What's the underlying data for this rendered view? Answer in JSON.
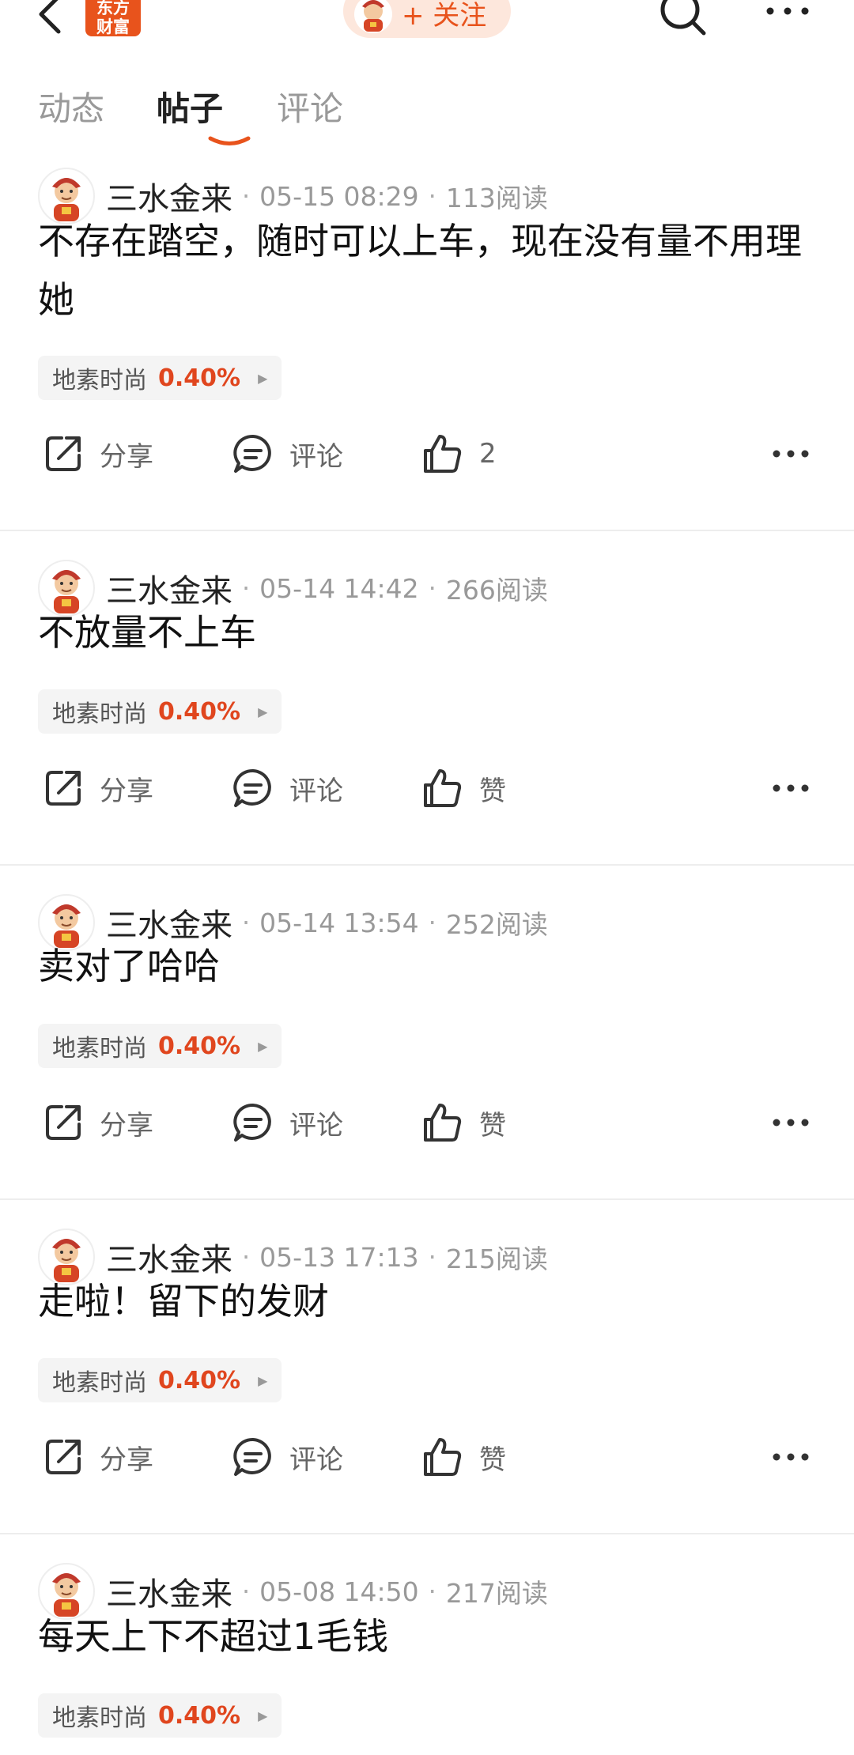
{
  "header": {
    "logo_line1": "东方",
    "logo_line2": "财富",
    "follow_label": "+ 关注"
  },
  "tabs": [
    {
      "label": "动态"
    },
    {
      "label": "帖子"
    },
    {
      "label": "评论"
    }
  ],
  "actions": {
    "share": "分享",
    "comment": "评论",
    "like": "赞"
  },
  "posts": [
    {
      "user": "三水金来",
      "time": "05-15 08:29",
      "reads": "113阅读",
      "content": "不存在踏空，随时可以上车，现在没有量不用理她",
      "stock": "地素时尚",
      "pct": "0.40%",
      "likes": "2"
    },
    {
      "user": "三水金来",
      "time": "05-14 14:42",
      "reads": "266阅读",
      "content": "不放量不上车",
      "stock": "地素时尚",
      "pct": "0.40%",
      "likes": "赞"
    },
    {
      "user": "三水金来",
      "time": "05-14 13:54",
      "reads": "252阅读",
      "content": "卖对了哈哈",
      "stock": "地素时尚",
      "pct": "0.40%",
      "likes": "赞"
    },
    {
      "user": "三水金来",
      "time": "05-13 17:13",
      "reads": "215阅读",
      "content": "走啦！留下的发财",
      "stock": "地素时尚",
      "pct": "0.40%",
      "likes": "赞"
    },
    {
      "user": "三水金来",
      "time": "05-08 14:50",
      "reads": "217阅读",
      "content": "每天上下不超过1毛钱",
      "stock": "地素时尚",
      "pct": "0.40%"
    }
  ],
  "colors": {
    "accent": "#e8531c",
    "stock_pct": "#e0461e"
  }
}
